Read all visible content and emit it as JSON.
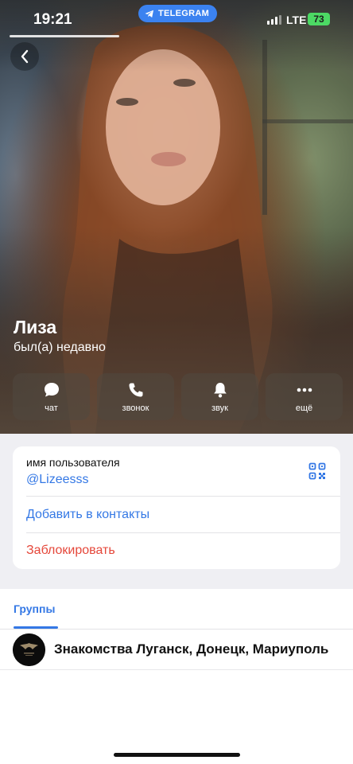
{
  "status_bar": {
    "time": "19:21",
    "app_pill": "TELEGRAM",
    "network": "LTE",
    "battery": "73"
  },
  "profile": {
    "name": "Лиза",
    "status": "был(а) недавно"
  },
  "actions": [
    {
      "label": "чат",
      "icon": "chat-bubble-icon"
    },
    {
      "label": "звонок",
      "icon": "phone-icon"
    },
    {
      "label": "звук",
      "icon": "bell-icon"
    },
    {
      "label": "ещё",
      "icon": "more-dots-icon"
    }
  ],
  "info": {
    "username_caption": "имя пользователя",
    "username_value": "@Lizeesss",
    "add_contact": "Добавить в контакты",
    "block": "Заблокировать"
  },
  "tabs": {
    "groups": "Группы"
  },
  "groups": [
    {
      "title": "Знакомства Луганск, Донецк, Мариуполь"
    }
  ],
  "colors": {
    "accent": "#3478e5",
    "danger": "#e5473a",
    "battery": "#4cd964",
    "pill": "#3b82f0"
  }
}
